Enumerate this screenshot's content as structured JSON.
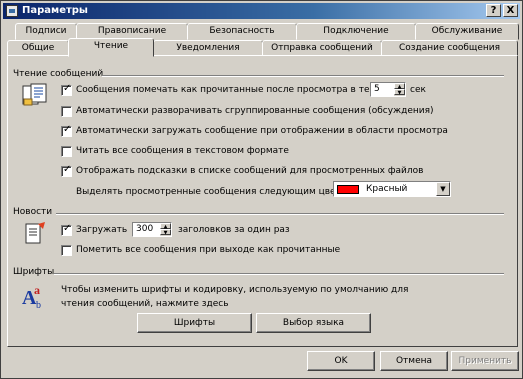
{
  "window": {
    "title": "Параметры",
    "help_btn": "?",
    "close_btn": "X"
  },
  "tabs": {
    "row_back": [
      "Подписи",
      "Правописание",
      "Безопасность",
      "Подключение",
      "Обслуживание"
    ],
    "row_front": [
      "Общие",
      "Чтение",
      "Уведомления",
      "Отправка сообщений",
      "Создание сообщения"
    ],
    "active": "Чтение"
  },
  "reading": {
    "group_title": "Чтение сообщений",
    "opt_mark_read": "Сообщения помечать как прочитанные после просмотра в течение",
    "mark_read_seconds": "5",
    "seconds_unit": "сек",
    "opt_expand_threads": "Автоматически разворачивать сгруппированные сообщения (обсуждения)",
    "opt_auto_download": "Автоматически загружать сообщение при отображении в области просмотра",
    "opt_plain_text": "Читать все сообщения в текстовом формате",
    "opt_tooltips": "Отображать подсказки в списке сообщений для просмотренных файлов",
    "highlight_label": "Выделять просмотренные сообщения следующим цветом:",
    "highlight_color_name": "Красный",
    "highlight_color": "#ff0000"
  },
  "news": {
    "group_title": "Новости",
    "opt_download": "Загружать",
    "download_count": "300",
    "download_suffix": "заголовков за один раз",
    "opt_mark_all_read": "Пометить все сообщения при выходе как прочитанные"
  },
  "fonts": {
    "group_title": "Шрифты",
    "description": "Чтобы изменить шрифты и кодировку, используемую по умолчанию для чтения сообщений, нажмите здесь",
    "fonts_button": "Шрифты",
    "encoding_button": "Выбор языка"
  },
  "footer": {
    "ok": "OK",
    "cancel": "Отмена",
    "apply": "Применить"
  }
}
